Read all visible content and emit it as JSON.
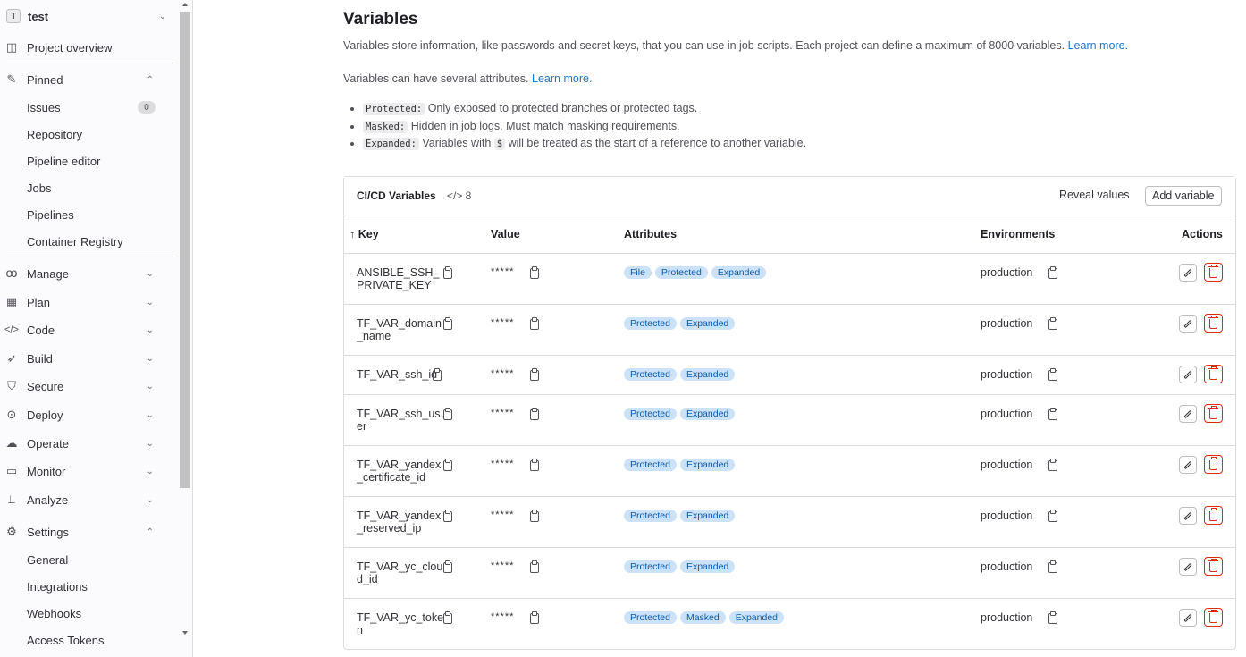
{
  "sidebar": {
    "project": {
      "avatar": "T",
      "name": "test"
    },
    "items": [
      {
        "label": "Project overview",
        "icon": "project-icon"
      },
      {
        "label": "Pinned",
        "icon": "pin-icon"
      },
      {
        "label": "Issues",
        "count": "0"
      },
      {
        "label": "Repository"
      },
      {
        "label": "Pipeline editor"
      },
      {
        "label": "Jobs"
      },
      {
        "label": "Pipelines"
      },
      {
        "label": "Container Registry"
      },
      {
        "label": "Manage",
        "icon": "users-icon"
      },
      {
        "label": "Plan",
        "icon": "planning-icon"
      },
      {
        "label": "Code",
        "icon": "code-icon"
      },
      {
        "label": "Build",
        "icon": "rocket-icon"
      },
      {
        "label": "Secure",
        "icon": "shield-icon"
      },
      {
        "label": "Deploy",
        "icon": "deployments-icon"
      },
      {
        "label": "Operate",
        "icon": "cloud-icon"
      },
      {
        "label": "Monitor",
        "icon": "monitor-icon"
      },
      {
        "label": "Analyze",
        "icon": "chart-icon"
      },
      {
        "label": "Settings",
        "icon": "gear-icon"
      },
      {
        "label": "General"
      },
      {
        "label": "Integrations"
      },
      {
        "label": "Webhooks"
      },
      {
        "label": "Access Tokens"
      }
    ]
  },
  "page": {
    "title": "Variables",
    "desc1": "Variables store information, like passwords and secret keys, that you can use in job scripts. Each project can define a maximum of 8000 variables.",
    "desc1_link": "Learn more.",
    "desc2": "Variables can have several attributes.",
    "desc2_link": "Learn more.",
    "attributes": [
      {
        "code": "Protected:",
        "text": "Only exposed to protected branches or protected tags."
      },
      {
        "code": "Masked:",
        "text": "Hidden in job logs. Must match masking requirements."
      },
      {
        "code": "Expanded:",
        "text_before": "Variables with",
        "code2": "$",
        "text": "will be treated as the start of a reference to another variable."
      }
    ]
  },
  "table": {
    "title": "CI/CD Variables",
    "count": "</> 8",
    "reveal_label": "Reveal values",
    "add_label": "Add variable",
    "headers": {
      "key": "↑ Key",
      "value": "Value",
      "attributes": "Attributes",
      "environments": "Environments",
      "actions": "Actions"
    },
    "rows": [
      {
        "key": "ANSIBLE_SSH_PRIVATE_KEY",
        "value": "*****",
        "attributes": [
          "File",
          "Protected",
          "Expanded"
        ],
        "env": "production"
      },
      {
        "key": "TF_VAR_domain_name",
        "value": "*****",
        "attributes": [
          "Protected",
          "Expanded"
        ],
        "env": "production"
      },
      {
        "key": "TF_VAR_ssh_id",
        "value": "*****",
        "attributes": [
          "Protected",
          "Expanded"
        ],
        "env": "production"
      },
      {
        "key": "TF_VAR_ssh_user",
        "value": "*****",
        "attributes": [
          "Protected",
          "Expanded"
        ],
        "env": "production"
      },
      {
        "key": "TF_VAR_yandex_certificate_id",
        "value": "*****",
        "attributes": [
          "Protected",
          "Expanded"
        ],
        "env": "production"
      },
      {
        "key": "TF_VAR_yandex_reserved_ip",
        "value": "*****",
        "attributes": [
          "Protected",
          "Expanded"
        ],
        "env": "production"
      },
      {
        "key": "TF_VAR_yc_cloud_id",
        "value": "*****",
        "attributes": [
          "Protected",
          "Expanded"
        ],
        "env": "production"
      },
      {
        "key": "TF_VAR_yc_token",
        "value": "*****",
        "attributes": [
          "Protected",
          "Masked",
          "Expanded"
        ],
        "env": "production"
      }
    ]
  }
}
